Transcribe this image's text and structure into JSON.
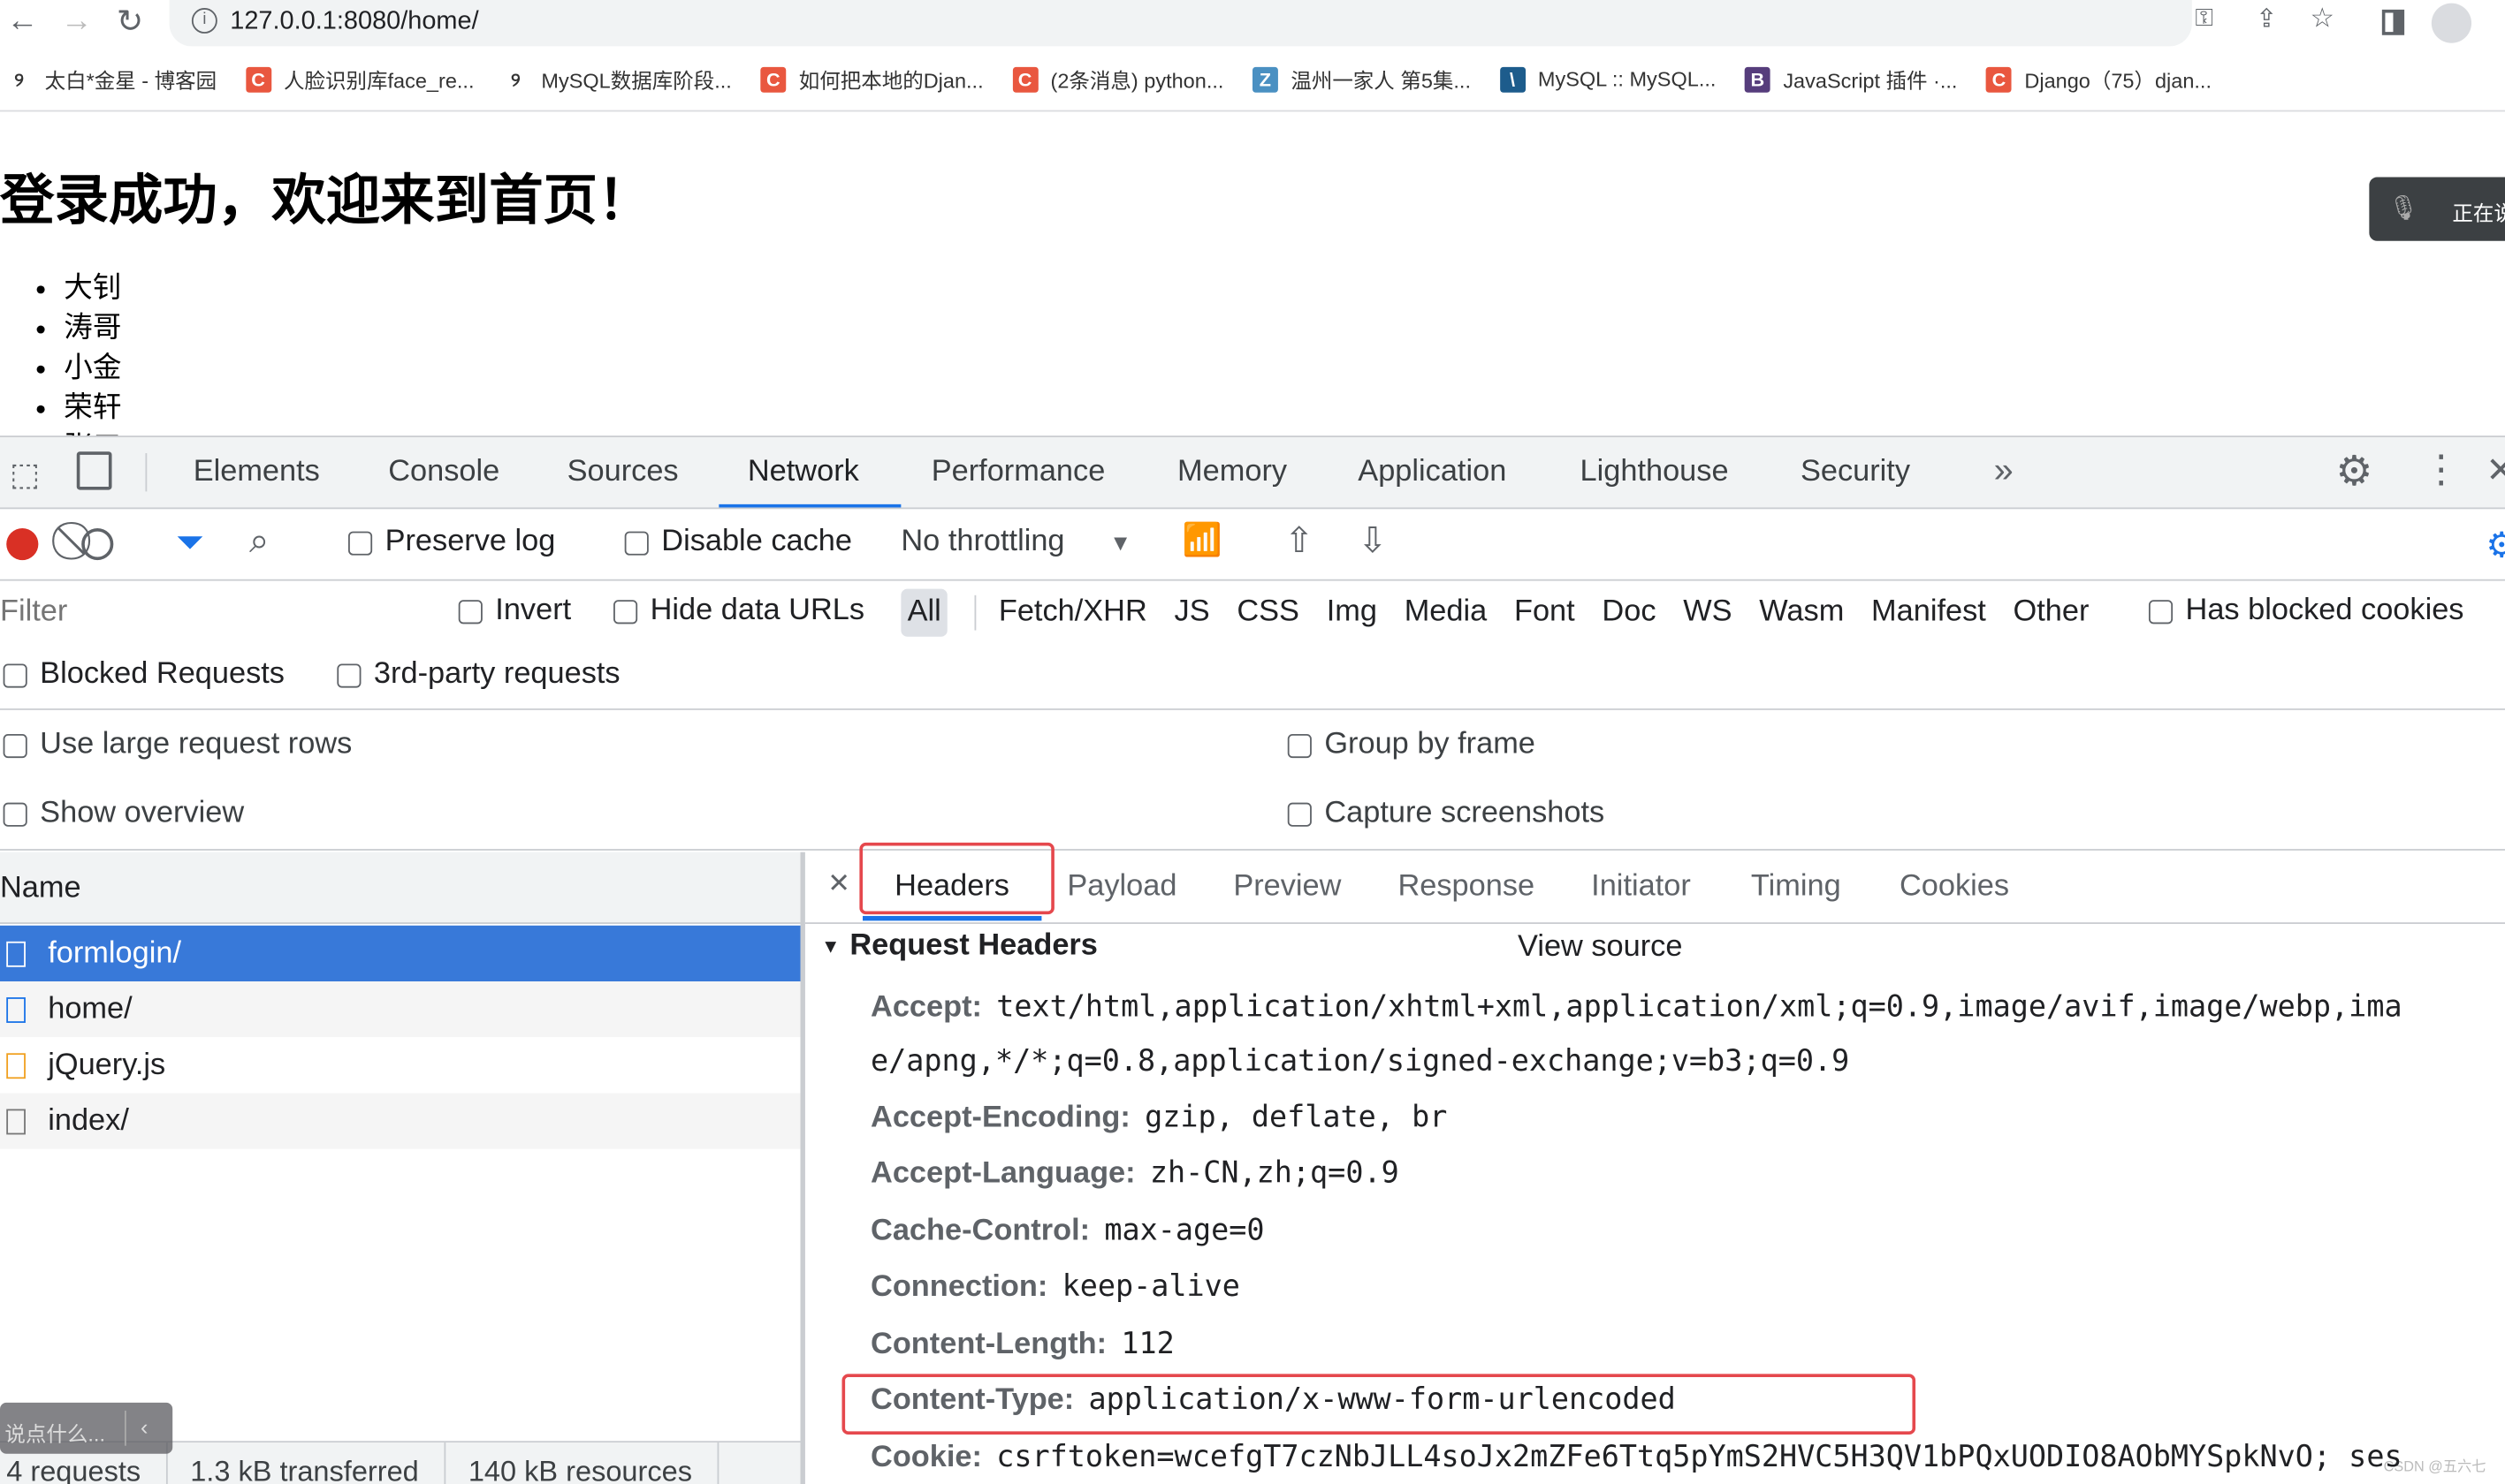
{
  "browser": {
    "url": "127.0.0.1:8080/home/",
    "bookmarks": [
      {
        "label": "太白*金星 - 博客园",
        "icon": "cnblogs-icon",
        "color": "#333333"
      },
      {
        "label": "人脸识别库face_re...",
        "icon": "csdn-icon",
        "color": "#e9573f"
      },
      {
        "label": "MySQL数据库阶段...",
        "icon": "cnblogs-icon",
        "color": "#333333"
      },
      {
        "label": "如何把本地的Djan...",
        "icon": "csdn-icon",
        "color": "#e9573f"
      },
      {
        "label": "(2条消息) python...",
        "icon": "csdn-icon",
        "color": "#e9573f"
      },
      {
        "label": "温州一家人 第5集...",
        "icon": "z-icon",
        "color": "#4a90c2"
      },
      {
        "label": "MySQL :: MySQL...",
        "icon": "mysql-icon",
        "color": "#1d5c8c"
      },
      {
        "label": "JavaScript 插件 ·...",
        "icon": "bootstrap-icon",
        "color": "#563d7c"
      },
      {
        "label": "Django（75）djan...",
        "icon": "csdn-icon",
        "color": "#e9573f"
      }
    ]
  },
  "page": {
    "title": "登录成功，欢迎来到首页！",
    "items": [
      "大钊",
      "涛哥",
      "小金",
      "荣轩",
      "张三"
    ],
    "voice_label": "正在说"
  },
  "devtools": {
    "tabs": [
      "Elements",
      "Console",
      "Sources",
      "Network",
      "Performance",
      "Memory",
      "Application",
      "Lighthouse",
      "Security"
    ],
    "active_tab": "Network",
    "toolbar": {
      "preserve_log": "Preserve log",
      "disable_cache": "Disable cache",
      "throttling": "No throttling"
    },
    "filter": {
      "placeholder": "Filter",
      "invert": "Invert",
      "hide_data_urls": "Hide data URLs",
      "types": [
        "All",
        "Fetch/XHR",
        "JS",
        "CSS",
        "Img",
        "Media",
        "Font",
        "Doc",
        "WS",
        "Wasm",
        "Manifest",
        "Other"
      ],
      "has_blocked_cookies": "Has blocked cookies",
      "blocked_requests": "Blocked Requests",
      "third_party": "3rd-party requests"
    },
    "settings": {
      "large_rows": "Use large request rows",
      "show_overview": "Show overview",
      "group_by_frame": "Group by frame",
      "capture_screenshots": "Capture screenshots"
    },
    "name_header": "Name",
    "requests": [
      {
        "name": "formlogin/",
        "type": "doc",
        "selected": true
      },
      {
        "name": "home/",
        "type": "doc"
      },
      {
        "name": "jQuery.js",
        "type": "script"
      },
      {
        "name": "index/",
        "type": "other"
      }
    ],
    "detail_tabs": [
      "Headers",
      "Payload",
      "Preview",
      "Response",
      "Initiator",
      "Timing",
      "Cookies"
    ],
    "request_headers_title": "Request Headers",
    "view_source": "View source",
    "headers": [
      {
        "name": "Accept:",
        "value": "text/html,application/xhtml+xml,application/xml;q=0.9,image/avif,image/webp,ima"
      },
      {
        "name": "",
        "value": "e/apng,*/*;q=0.8,application/signed-exchange;v=b3;q=0.9"
      },
      {
        "name": "Accept-Encoding:",
        "value": "gzip, deflate, br"
      },
      {
        "name": "Accept-Language:",
        "value": "zh-CN,zh;q=0.9"
      },
      {
        "name": "Cache-Control:",
        "value": "max-age=0"
      },
      {
        "name": "Connection:",
        "value": "keep-alive"
      },
      {
        "name": "Content-Length:",
        "value": "112"
      },
      {
        "name": "Content-Type:",
        "value": "application/x-www-form-urlencoded"
      },
      {
        "name": "Cookie:",
        "value": "csrftoken=wcefgT7czNbJLL4soJx2mZFe6Ttq5pYmS2HVC5H3QV1bPQxUODIO8AObMYSpkNvO; ses"
      }
    ],
    "status": [
      "4 requests",
      "1.3 kB transferred",
      "140 kB resources"
    ],
    "chat_placeholder": "说点什么...",
    "watermark": "CSDN @五六七",
    "colors": {
      "selected_row": "#3879d9",
      "highlight_box": "#e5484d",
      "active_tab_underline": "#1a73e8",
      "record": "#d93025"
    }
  }
}
